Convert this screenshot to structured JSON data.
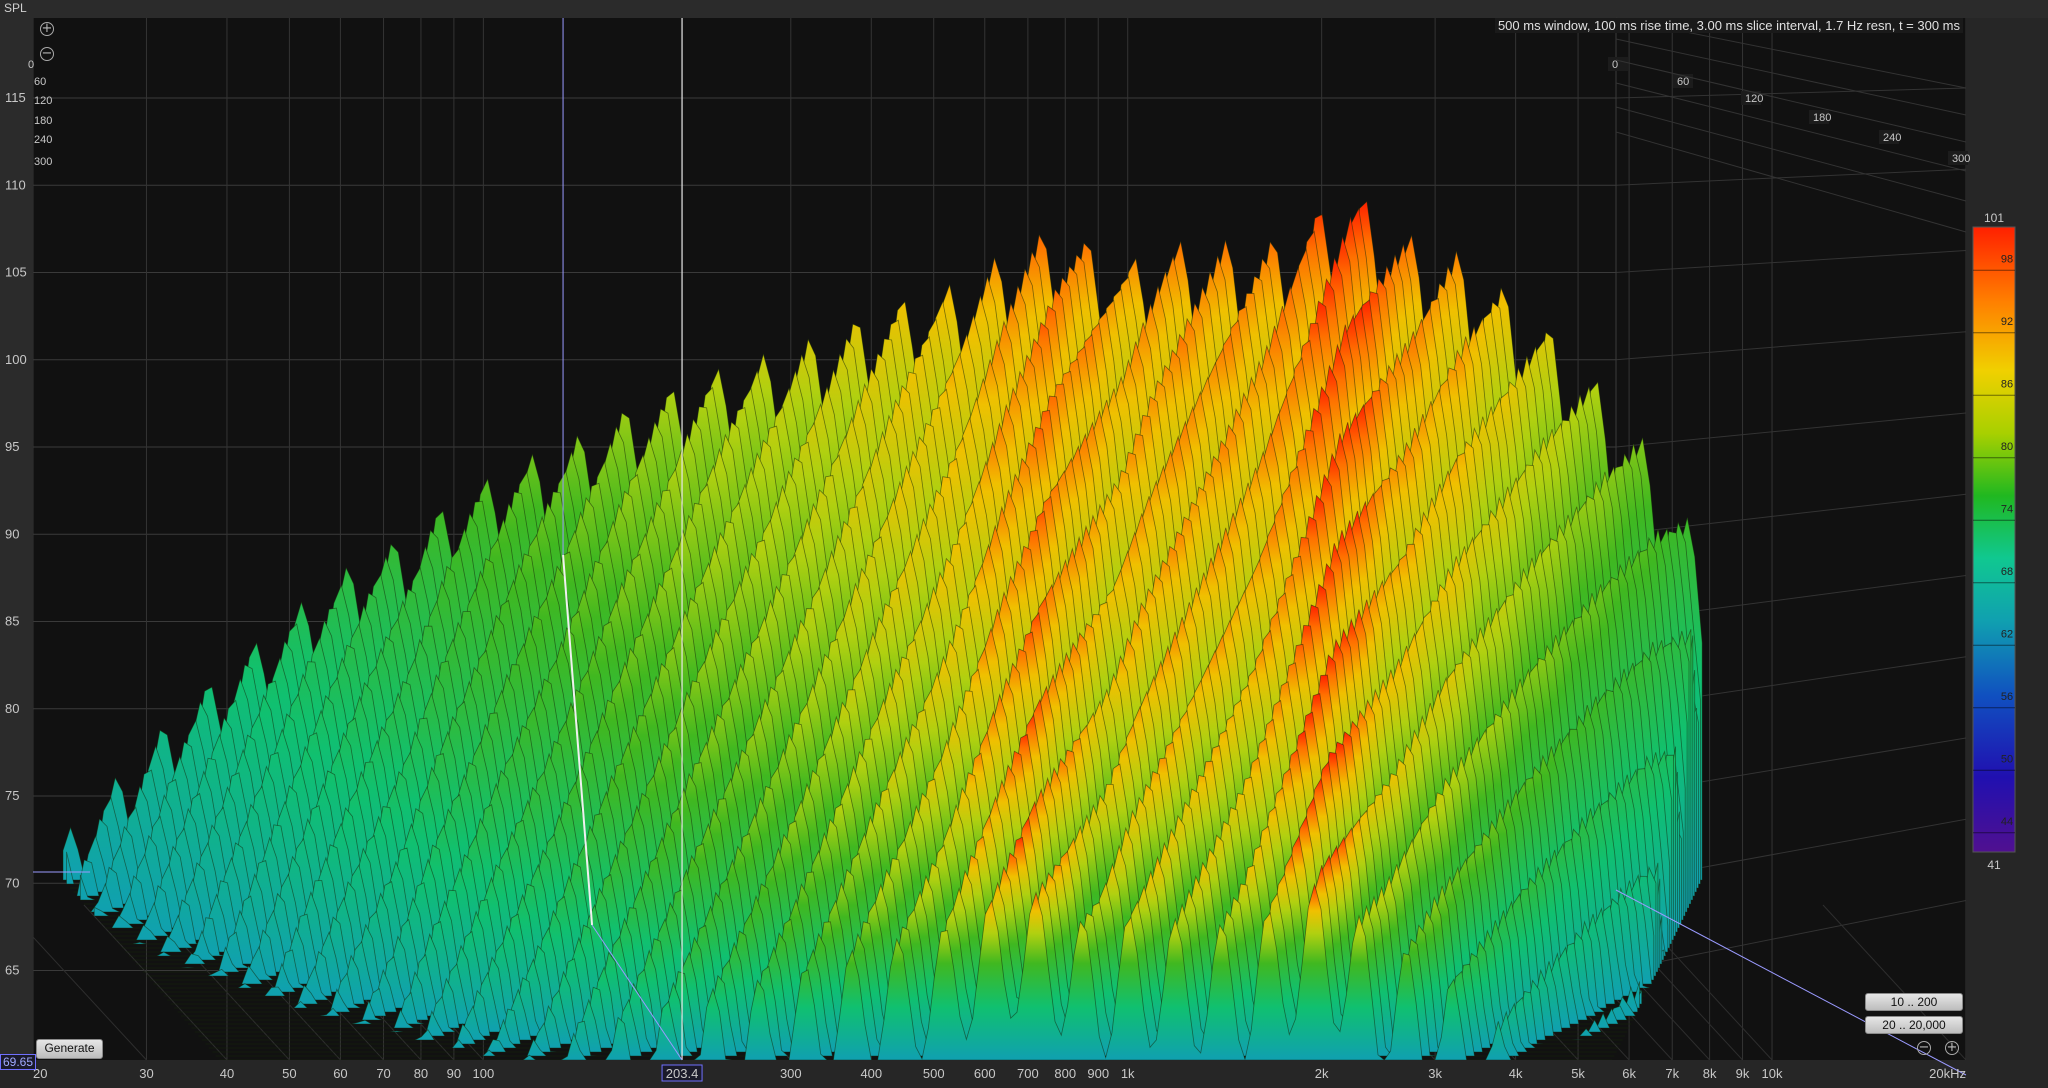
{
  "top_label": "SPL",
  "info": "500 ms window, 100 ms rise time, 3.00 ms slice interval, 1.7 Hz resn, t = 300 ms",
  "cursor_value": "69.65",
  "cursor_freq": "203.4",
  "buttons": {
    "generate": "Generate",
    "range_200": "10 .. 200",
    "range_20000": "20 .. 20,000"
  },
  "zoom": {
    "in": "+",
    "out": "−"
  },
  "colors": {
    "background_plot": "#111111",
    "grid": "#3a3a3a",
    "cursor_white": "#e8e8e8",
    "cursor_blue": "#9a9aff"
  },
  "chart_data": {
    "type": "waterfall",
    "title": "",
    "ylabel": "SPL",
    "xlabel": "",
    "y_axis": {
      "ticks": [
        115,
        110,
        105,
        100,
        95,
        90,
        85,
        80,
        75,
        70,
        65
      ],
      "ylim": [
        62,
        118
      ]
    },
    "x_axis": {
      "scale": "log",
      "xlim": [
        20,
        20000
      ],
      "tick_labels": [
        "20",
        "30",
        "40",
        "50",
        "60",
        "70",
        "80",
        "90",
        "100",
        "300",
        "400",
        "500",
        "600",
        "700",
        "800",
        "900",
        "1k",
        "2k",
        "3k",
        "4k",
        "5k",
        "6k",
        "7k",
        "8k",
        "9k",
        "10k",
        "20kHz"
      ],
      "tick_values": [
        20,
        30,
        40,
        50,
        60,
        70,
        80,
        90,
        100,
        300,
        400,
        500,
        600,
        700,
        800,
        900,
        1000,
        2000,
        3000,
        4000,
        5000,
        6000,
        7000,
        8000,
        9000,
        10000,
        20000
      ]
    },
    "time_axis": {
      "unit": "ms",
      "tick_labels_right": [
        "0",
        "60",
        "120",
        "180",
        "240",
        "300"
      ],
      "tick_labels_left": [
        "0",
        "60",
        "120",
        "180",
        "240",
        "300"
      ]
    },
    "color_scale": {
      "max_label": "101",
      "min_label": "41",
      "ticks": [
        98,
        92,
        86,
        80,
        74,
        68,
        62,
        56,
        50,
        44
      ],
      "stops": [
        "#ff2000",
        "#ff8000",
        "#f0d000",
        "#a8d000",
        "#20b820",
        "#10c890",
        "#10a0b0",
        "#1050c0",
        "#2010b0",
        "#501090"
      ]
    },
    "front_slice_peaks": {
      "freq_hz": [
        20,
        30,
        40,
        50,
        60,
        70,
        80,
        90,
        100,
        120,
        150,
        200,
        250,
        300,
        400,
        500,
        600,
        700,
        800,
        900,
        1000,
        1500,
        2000,
        2500,
        3000,
        4000,
        5000,
        6000,
        7000
      ],
      "spl_db": [
        70,
        77,
        81,
        84,
        86,
        87,
        89,
        90,
        91,
        92,
        94,
        96,
        97,
        98,
        100,
        101,
        103,
        104,
        103,
        102,
        103,
        103,
        106,
        103,
        102,
        98,
        94,
        90,
        85
      ]
    },
    "cursor": {
      "freq_hz": 203.4,
      "spl_db": 69.65
    }
  }
}
